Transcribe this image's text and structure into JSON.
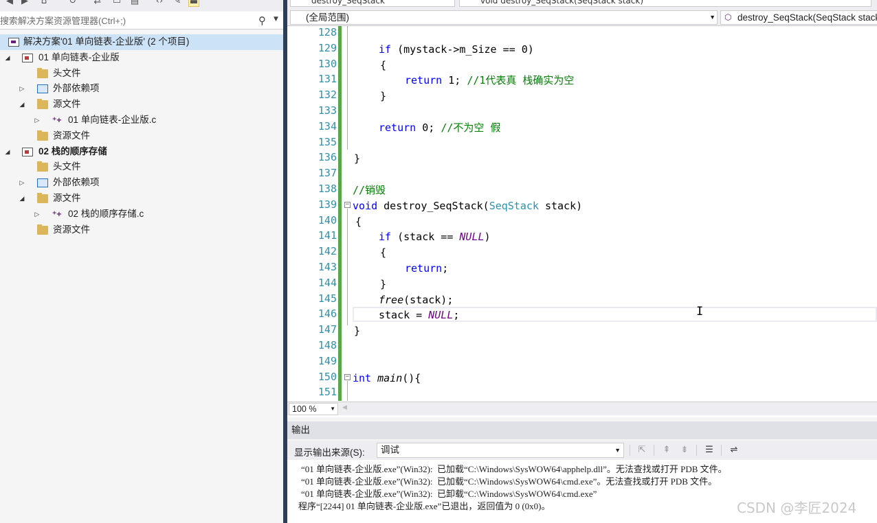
{
  "solution_explorer": {
    "search_placeholder": "搜索解决方案资源管理器(Ctrl+;)",
    "solution_label": "解决方案'01 单向链表-企业版' (2 个项目)",
    "projects": [
      {
        "name": "01 单向链表-企业版",
        "items": {
          "headers": "头文件",
          "external": "外部依赖项",
          "sources": "源文件",
          "source_file": "01 单向链表-企业版.c",
          "resources": "资源文件"
        }
      },
      {
        "name": "02 栈的顺序存储",
        "items": {
          "headers": "头文件",
          "external": "外部依赖项",
          "sources": "源文件",
          "source_file": "02 栈的顺序存储.c",
          "resources": "资源文件"
        }
      }
    ]
  },
  "editor": {
    "top_partial_left": "destroy_SeqStack",
    "top_partial_right": "void destroy_SeqStack(SeqStack stack)",
    "scope": "(全局范围)",
    "function": "destroy_SeqStack(SeqStack stack)",
    "zoom": "100 %",
    "line_numbers": [
      "128",
      "129",
      "130",
      "131",
      "132",
      "133",
      "134",
      "135",
      "136",
      "137",
      "138",
      "139",
      "140",
      "141",
      "142",
      "143",
      "144",
      "145",
      "146",
      "147",
      "148",
      "149",
      "150",
      "151"
    ],
    "code": {
      "l129_kw": "if",
      "l129_rest": " (mystack->m_Size == 0)",
      "l130": "{",
      "l131_kw": "return",
      "l131_rest": " 1; ",
      "l131_cm": "//1代表真 栈确实为空",
      "l132": "}",
      "l134_kw": "return",
      "l134_rest": " 0; ",
      "l134_cm": "//不为空 假",
      "l136": "}",
      "l138_cm": "//销毁",
      "l139_kw": "void",
      "l139_fn": " destroy_SeqStack(",
      "l139_ty": "SeqStack",
      "l139_rest": " stack)",
      "l140": "{",
      "l141_kw": "if",
      "l141_a": " (stack == ",
      "l141_mac": "NULL",
      "l141_b": ")",
      "l142": "{",
      "l143_kw": "return",
      "l143_rest": ";",
      "l144": "}",
      "l145_fn": "free",
      "l145_rest": "(stack);",
      "l146_a": "stack = ",
      "l146_mac": "NULL",
      "l146_b": ";",
      "l147": "}",
      "l150_kw": "int",
      "l150_sp": " ",
      "l150_fn": "main",
      "l150_rest": "(){"
    }
  },
  "output": {
    "title": "输出",
    "source_label": "显示输出来源(S):",
    "source_value": "调试",
    "lines": [
      "“01 单向链表-企业版.exe”(Win32):  已加载“C:\\Windows\\SysWOW64\\apphelp.dll”。无法查找或打开 PDB 文件。",
      "“01 单向链表-企业版.exe”(Win32):  已加载“C:\\Windows\\SysWOW64\\cmd.exe”。无法查找或打开 PDB 文件。",
      "“01 单向链表-企业版.exe”(Win32):  已卸载“C:\\Windows\\SysWOW64\\cmd.exe”",
      "程序“[2244] 01 单向链表-企业版.exe”已退出，返回值为 0 (0x0)。"
    ],
    "watermark": "CSDN @李匠2024"
  }
}
